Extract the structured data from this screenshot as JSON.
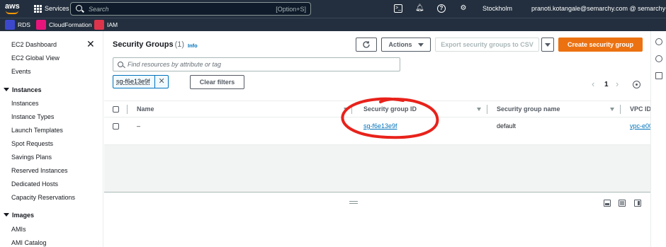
{
  "topnav": {
    "logo_text": "aws",
    "services_label": "Services",
    "search_placeholder": "Search",
    "search_shortcut": "[Option+S]",
    "region": "Stockholm",
    "account": "pranoti.kotangale@semarchy.com @ semarchy-inc",
    "icons": [
      "cloudshell-icon",
      "bell-icon",
      "help-icon",
      "gear-icon"
    ]
  },
  "favorites": [
    {
      "label": "RDS",
      "color": "#3b48cc"
    },
    {
      "label": "CloudFormation",
      "color": "#e7157b"
    },
    {
      "label": "IAM",
      "color": "#dd344c"
    }
  ],
  "sidebar": {
    "items_top": [
      "EC2 Dashboard",
      "EC2 Global View",
      "Events"
    ],
    "sections": [
      {
        "title": "Instances",
        "items": [
          "Instances",
          "Instance Types",
          "Launch Templates",
          "Spot Requests",
          "Savings Plans",
          "Reserved Instances",
          "Dedicated Hosts",
          "Capacity Reservations"
        ]
      },
      {
        "title": "Images",
        "items": [
          "AMIs",
          "AMI Catalog"
        ]
      }
    ]
  },
  "main": {
    "title": "Security Groups",
    "count": "(1)",
    "info_label": "Info",
    "actions_label": "Actions",
    "export_label": "Export security groups to CSV",
    "create_label": "Create security group",
    "filter_placeholder": "Find resources by attribute or tag",
    "filter_token": "sg-f6e13e9f",
    "clear_filters_label": "Clear filters",
    "page_number": "1",
    "columns": [
      "Name",
      "Security group ID",
      "Security group name",
      "VPC ID"
    ],
    "rows": [
      {
        "name": "–",
        "security_group_id": "sg-f6e13e9f",
        "security_group_name": "default",
        "vpc_id": "vpc-e00"
      }
    ]
  },
  "colors": {
    "nav_bg": "#232f3e",
    "primary_orange": "#ec7211",
    "link_blue": "#0073bb",
    "annotation_red": "#e8221b"
  }
}
